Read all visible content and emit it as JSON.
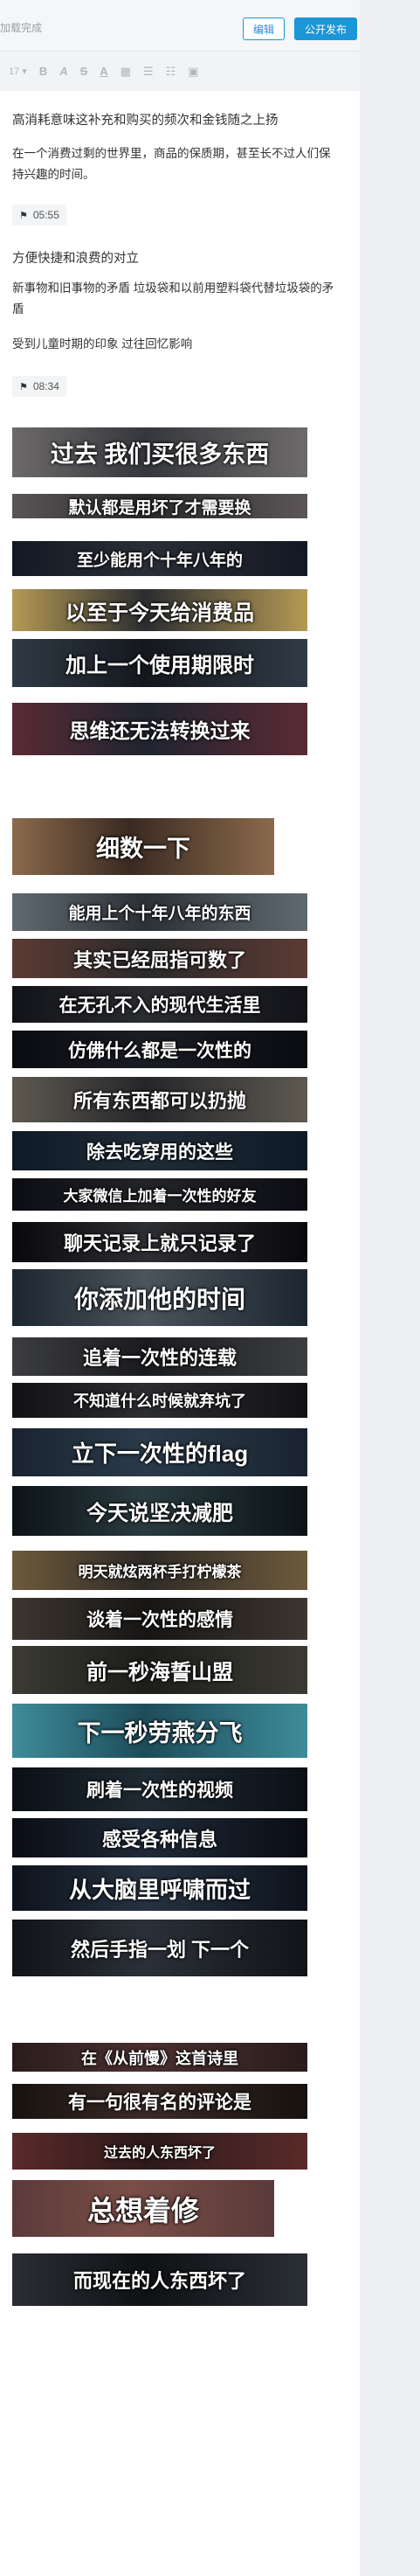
{
  "header": {
    "status": "加载完成",
    "edit_label": "编辑",
    "publish_label": "公开发布",
    "accent": "#1b96d6"
  },
  "toolbar": {
    "font_size": "17",
    "bold": "B",
    "italic": "A",
    "strike": "S",
    "color": "A",
    "icons": [
      "format-icon",
      "ordered-list-icon",
      "bullet-list-icon",
      "image-icon"
    ]
  },
  "body": {
    "p1": "高消耗意味这补充和购买的频次和金钱随之上扬",
    "p2": "在一个消费过剩的世界里，商品的保质期，甚至长不过人们保持兴趣的时间。",
    "ts1": "05:55",
    "p3": "方便快捷和浪费的对立",
    "p4": "新事物和旧事物的矛盾 垃圾袋和以前用塑料袋代替垃圾袋的矛盾",
    "p5": "受到儿童时期的印象 过往回忆影响",
    "ts2": "08:34"
  },
  "frames": [
    "过去 我们买很多东西",
    "默认都是用坏了才需要换",
    "至少能用个十年八年的",
    "以至于今天给消费品",
    "加上一个使用期限时",
    "思维还无法转换过来",
    "细数一下",
    "能用上个十年八年的东西",
    "其实已经屈指可数了",
    "在无孔不入的现代生活里",
    "仿佛什么都是一次性的",
    "所有东西都可以扔抛",
    "除去吃穿用的这些",
    "大家微信上加着一次性的好友",
    "聊天记录上就只记录了",
    "你添加他的时间",
    "追着一次性的连载",
    "不知道什么时候就弃坑了",
    "立下一次性的flag",
    "今天说坚决减肥",
    "明天就炫两杯手打柠檬茶",
    "谈着一次性的感情",
    "前一秒海誓山盟",
    "下一秒劳燕分飞",
    "刷着一次性的视频",
    "感受各种信息",
    "从大脑里呼啸而过",
    "然后手指一划 下一个",
    "在《从前慢》这首诗里",
    "有一句很有名的评论是",
    "过去的人东西坏了",
    "总想着修",
    "而现在的人东西坏了"
  ]
}
